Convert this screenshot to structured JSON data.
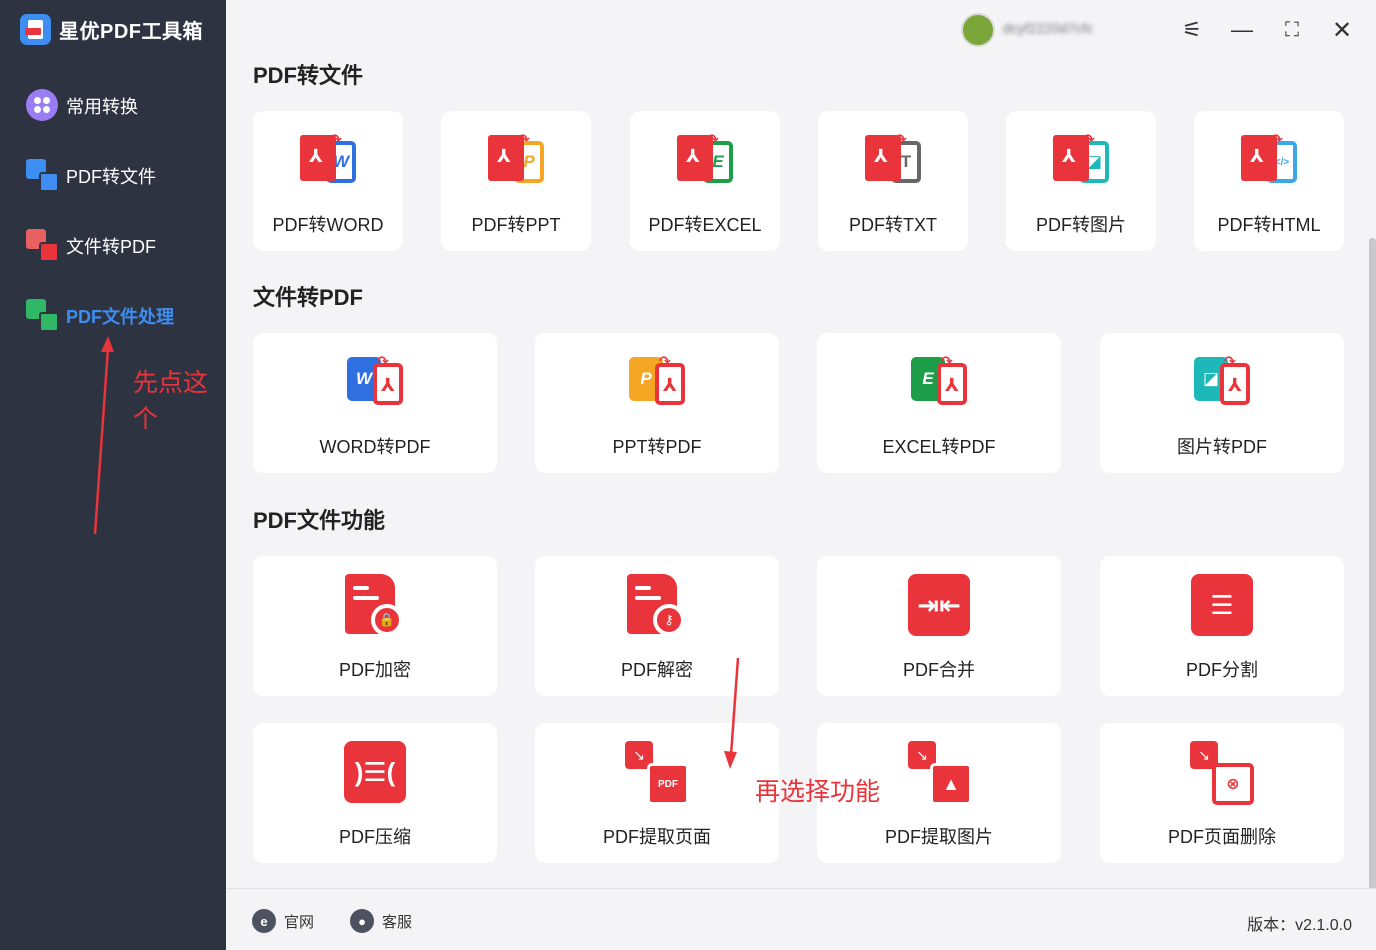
{
  "app": {
    "title": "星优PDF工具箱"
  },
  "sidebar": {
    "items": [
      {
        "label": "常用转换"
      },
      {
        "label": "PDF转文件"
      },
      {
        "label": "文件转PDF"
      },
      {
        "label": "PDF文件处理"
      }
    ]
  },
  "header": {
    "username": "dcyf2220d7cfc"
  },
  "sections": {
    "pdf_to_file": {
      "title": "PDF转文件",
      "cards": [
        {
          "label": "PDF转WORD",
          "letter": "W"
        },
        {
          "label": "PDF转PPT",
          "letter": "P"
        },
        {
          "label": "PDF转EXCEL",
          "letter": "E"
        },
        {
          "label": "PDF转TXT",
          "letter": "T"
        },
        {
          "label": "PDF转图片",
          "letter": "◪"
        },
        {
          "label": "PDF转HTML",
          "letter": "</>"
        }
      ]
    },
    "file_to_pdf": {
      "title": "文件转PDF",
      "cards": [
        {
          "label": "WORD转PDF",
          "letter": "W"
        },
        {
          "label": "PPT转PDF",
          "letter": "P"
        },
        {
          "label": "EXCEL转PDF",
          "letter": "E"
        },
        {
          "label": "图片转PDF",
          "letter": "◪"
        }
      ]
    },
    "pdf_functions": {
      "title": "PDF文件功能",
      "cards": [
        {
          "label": "PDF加密"
        },
        {
          "label": "PDF解密"
        },
        {
          "label": "PDF合并"
        },
        {
          "label": "PDF分割"
        },
        {
          "label": "PDF压缩"
        },
        {
          "label": "PDF提取页面",
          "badge": "PDF"
        },
        {
          "label": "PDF提取图片"
        },
        {
          "label": "PDF页面删除"
        }
      ]
    }
  },
  "annotations": {
    "first": "先点这个",
    "second": "再选择功能"
  },
  "footer": {
    "website": "官网",
    "support": "客服",
    "version": "版本：v2.1.0.0"
  },
  "colors": {
    "accent": "#3d8ef0",
    "red": "#e8343a",
    "sidebar": "#2e3341",
    "word": "#2f6fe0",
    "ppt": "#f5a623",
    "excel": "#1f9e4a",
    "txt": "#666666",
    "image": "#1fb8b8",
    "html": "#3aa8e8"
  }
}
